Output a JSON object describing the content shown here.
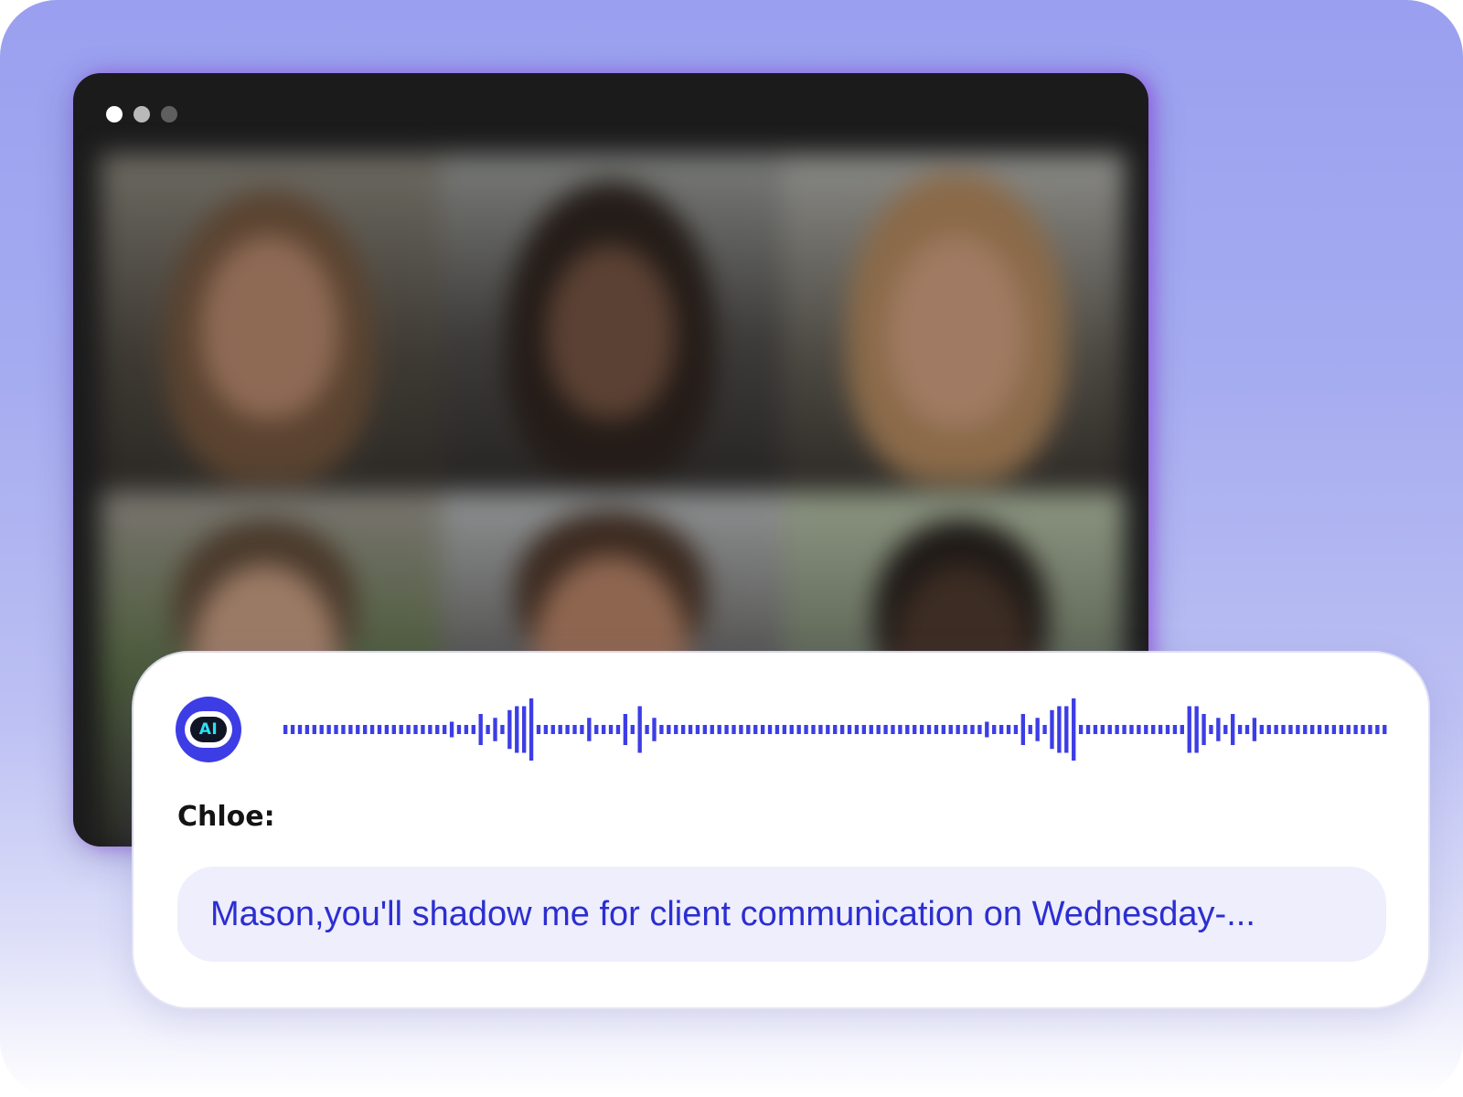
{
  "window": {
    "controls": [
      "close",
      "minimize",
      "maximize"
    ],
    "video_tiles": 6
  },
  "transcript": {
    "badge_text": "AI",
    "speaker": "Chloe:",
    "message": "Mason,you'll shadow me for client communication on Wednesday-...",
    "accent_color": "#3d3de6",
    "bubble_color": "#eeeefc"
  },
  "waveform": {
    "color": "#3d3de6",
    "levels": [
      1,
      1,
      1,
      1,
      1,
      1,
      1,
      1,
      1,
      1,
      1,
      1,
      1,
      1,
      1,
      1,
      1,
      1,
      1,
      1,
      1,
      1,
      1,
      2,
      1,
      1,
      1,
      4,
      1,
      3,
      1,
      5,
      6,
      6,
      8,
      1,
      1,
      1,
      1,
      1,
      1,
      1,
      3,
      1,
      1,
      1,
      1,
      4,
      1,
      6,
      1,
      3,
      1,
      1,
      1,
      1,
      1,
      1,
      1,
      1,
      1,
      1,
      1,
      1,
      1,
      1,
      1,
      1,
      1,
      1,
      1,
      1,
      1,
      1,
      1,
      1,
      1,
      1,
      1,
      1,
      1,
      1,
      1,
      1,
      1,
      1,
      1,
      1,
      1,
      1,
      1,
      1,
      1,
      1,
      1,
      1,
      1,
      2,
      1,
      1,
      1,
      1,
      4,
      1,
      3,
      1,
      5,
      6,
      6,
      8,
      1,
      1,
      1,
      1,
      1,
      1,
      1,
      1,
      1,
      1,
      1,
      1,
      1,
      1,
      1,
      6,
      6,
      4,
      1,
      3,
      1,
      4,
      1,
      1,
      3,
      1,
      1,
      1,
      1,
      1,
      1,
      1,
      1,
      1,
      1,
      1,
      1,
      1,
      1,
      1,
      1,
      1,
      1
    ]
  }
}
